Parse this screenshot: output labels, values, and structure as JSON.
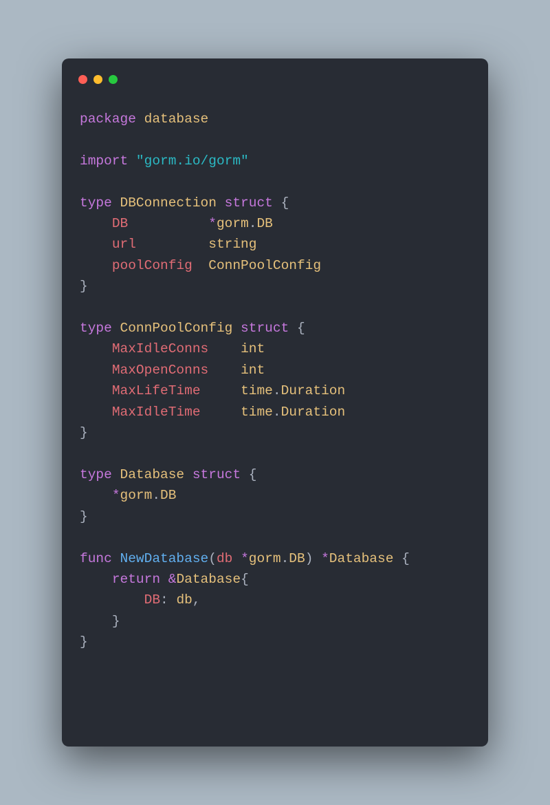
{
  "tokens": {
    "kw_package": "package",
    "kw_import": "import",
    "kw_type": "type",
    "kw_struct": "struct",
    "kw_func": "func",
    "kw_return": "return",
    "pkg_name": "database",
    "import_path": "\"gorm.io/gorm\"",
    "type_DBConnection": "DBConnection",
    "type_ConnPoolConfig": "ConnPoolConfig",
    "type_Database": "Database",
    "gorm": "gorm",
    "DB": "DB",
    "time": "time",
    "Duration": "Duration",
    "string": "string",
    "int": "int",
    "fn_NewDatabase": "NewDatabase",
    "param_db": "db",
    "field_DB": "DB",
    "field_url": "url",
    "field_poolConfig": "poolConfig",
    "field_MaxIdleConns": "MaxIdleConns",
    "field_MaxOpenConns": "MaxOpenConns",
    "field_MaxLifeTime": "MaxLifeTime",
    "field_MaxIdleTime": "MaxIdleTime"
  },
  "window": {
    "dot_red": "#ff5f56",
    "dot_yellow": "#ffbd2e",
    "dot_green": "#27c93f",
    "bg": "#282c34"
  }
}
